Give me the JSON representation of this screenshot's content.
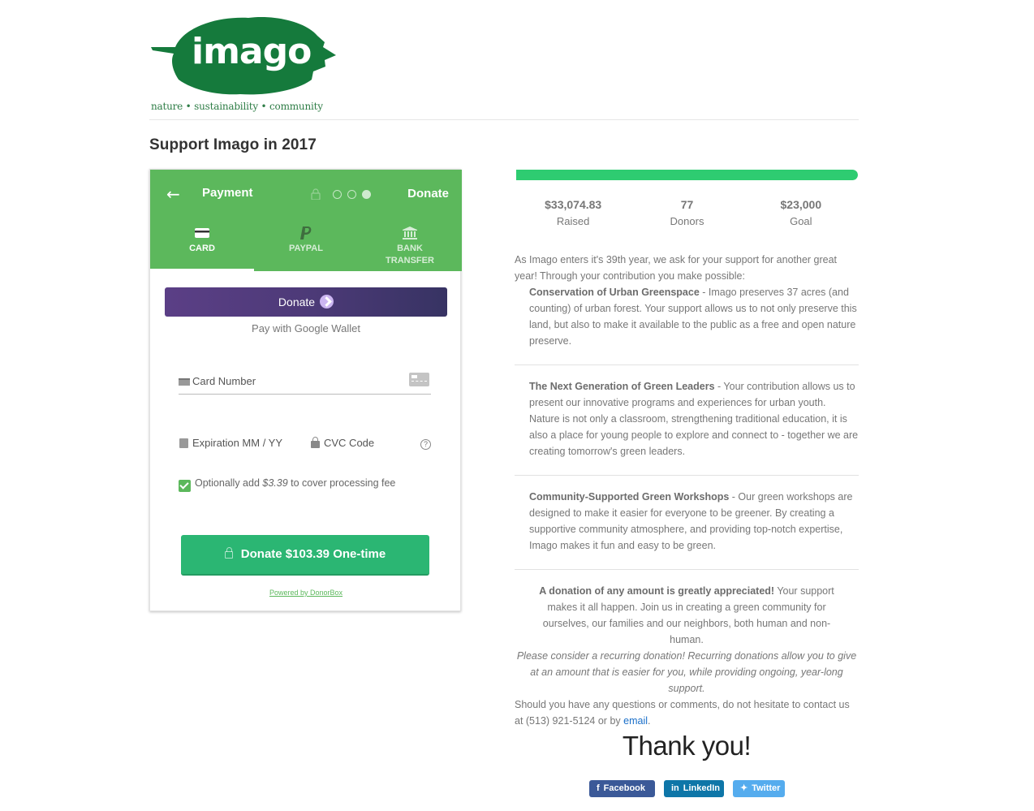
{
  "brand": {
    "logo_word": "imago",
    "tagline": "nature • sustainability • community",
    "leaf_color": "#157a3c"
  },
  "page_title": "Support Imago in 2017",
  "widget": {
    "header": {
      "back_icon": "arrow-left-icon",
      "title": "Payment",
      "steps_total": 3,
      "step_current": 3,
      "right_label": "Donate",
      "color": "#5cb85c"
    },
    "tabs": [
      {
        "label": "CARD",
        "icon": "credit-card-icon",
        "active": true
      },
      {
        "label": "PAYPAL",
        "icon": "paypal-icon",
        "active": false
      },
      {
        "label": "BANK TRANSFER",
        "icon": "bank-icon",
        "active": false
      }
    ],
    "google_pay": {
      "button_label": "Donate",
      "subtext": "Pay with Google Wallet"
    },
    "card_number": {
      "placeholder": "Card Number"
    },
    "expiration": {
      "placeholder": "Expiration MM / YY"
    },
    "cvc": {
      "placeholder": "CVC Code",
      "help": "?"
    },
    "fee": {
      "checked": true,
      "prefix": "Optionally add ",
      "amount": "$3.39",
      "suffix": " to cover processing fee"
    },
    "submit_label": "Donate $103.39 One-time",
    "powered_by": "Powered by DonorBox"
  },
  "campaign": {
    "progress_percent": 100,
    "raised": {
      "value": "$33,074.83",
      "label": "Raised"
    },
    "donors": {
      "value": "77",
      "label": "Donors"
    },
    "goal": {
      "value": "$23,000",
      "label": "Goal"
    }
  },
  "description": {
    "intro": "As Imago enters it's 39th year, we ask for your support for another great year! Through your contribution you make possible:",
    "items": [
      {
        "title": "Conservation of Urban Greenspace",
        "text": " - Imago preserves 37 acres (and counting) of urban forest. Your support allows us to not only preserve this land, but also to make it available to the public as a free and open nature preserve."
      },
      {
        "title": "The Next Generation of Green Leaders",
        "text": " - Your contribution allows us to present our innovative programs and experiences for urban youth. Nature is not only a classroom, strengthening traditional education, it is also a place for young people to explore and connect to - together we are creating tomorrow's green leaders."
      },
      {
        "title": "Community-Supported Green Workshops",
        "text": " - Our green workshops are designed to make it easier for everyone to be greener. By creating a supportive community atmosphere, and providing top-notch expertise, Imago makes it fun and easy to be green."
      }
    ],
    "appeal_bold": "A donation of any amount is greatly appreciated!",
    "appeal_text": " Your support makes it all happen. Join us in creating a green community for ourselves, our families and our neighbors, both human and non-human.",
    "recurring": "Please consider a recurring donation! Recurring donations allow you to give at an amount that is easier for you, while providing ongoing, year-long support.",
    "contact_prefix": "Should you have any questions or comments, do not hesitate to contact us at (513) 921-5124 or by ",
    "contact_link": "email",
    "contact_suffix": ".",
    "link_color": "#1a6fc9"
  },
  "thanks": "Thank you!",
  "social": [
    {
      "label": "Facebook",
      "glyph": "f",
      "icon": "facebook-icon",
      "color": "#3b5998"
    },
    {
      "label": "LinkedIn",
      "glyph": "in",
      "icon": "linkedin-icon",
      "color": "#0e76a8"
    },
    {
      "label": "Twitter",
      "glyph": "🐦",
      "icon": "twitter-icon",
      "color": "#55acee"
    }
  ]
}
